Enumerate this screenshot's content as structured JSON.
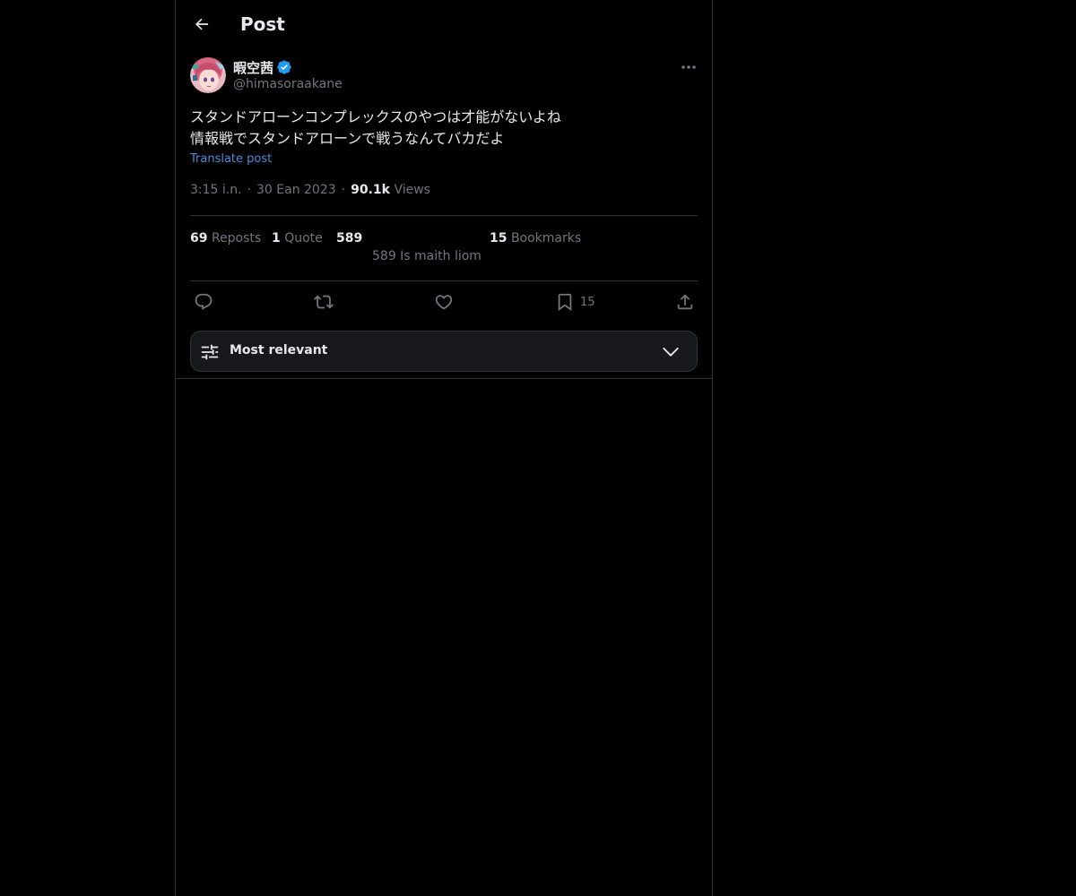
{
  "header": {
    "title": "Post"
  },
  "post": {
    "author": {
      "display_name": "暇空茜",
      "handle": "@himasoraakane",
      "verified": true
    },
    "text_lines": [
      "スタンドアローンコンプレックスのやつは才能がないよね",
      "情報戦でスタンドアローンで戦うなんてバカだよ"
    ],
    "translate_label": "Translate post",
    "time": "3:15 i.n.",
    "date": "30 Ean 2023",
    "separator": "·",
    "views_count": "90.1k",
    "views_label": "Views"
  },
  "stats": {
    "reposts_count": "69",
    "reposts_label": "Reposts",
    "quote_count": "1",
    "quote_label": "Quote",
    "likes_count": "589",
    "likes_sub": "589 Is maith liom",
    "bookmarks_count": "15",
    "bookmarks_label": "Bookmarks"
  },
  "actions": {
    "reply_icon": "reply-icon",
    "repost_icon": "repost-icon",
    "like_icon": "heart-icon",
    "bookmark_icon": "bookmark-icon",
    "bookmark_count": "15",
    "share_icon": "share-icon"
  },
  "sort": {
    "label": "Most relevant",
    "icon": "sliders-icon"
  },
  "colors": {
    "background": "#000000",
    "text_primary": "#e7e9ea",
    "text_secondary": "#71767b",
    "link": "#4d8eda",
    "border": "#2f3336",
    "verified": "#1d9bf0",
    "sort_bar_bg": "#16181c"
  }
}
